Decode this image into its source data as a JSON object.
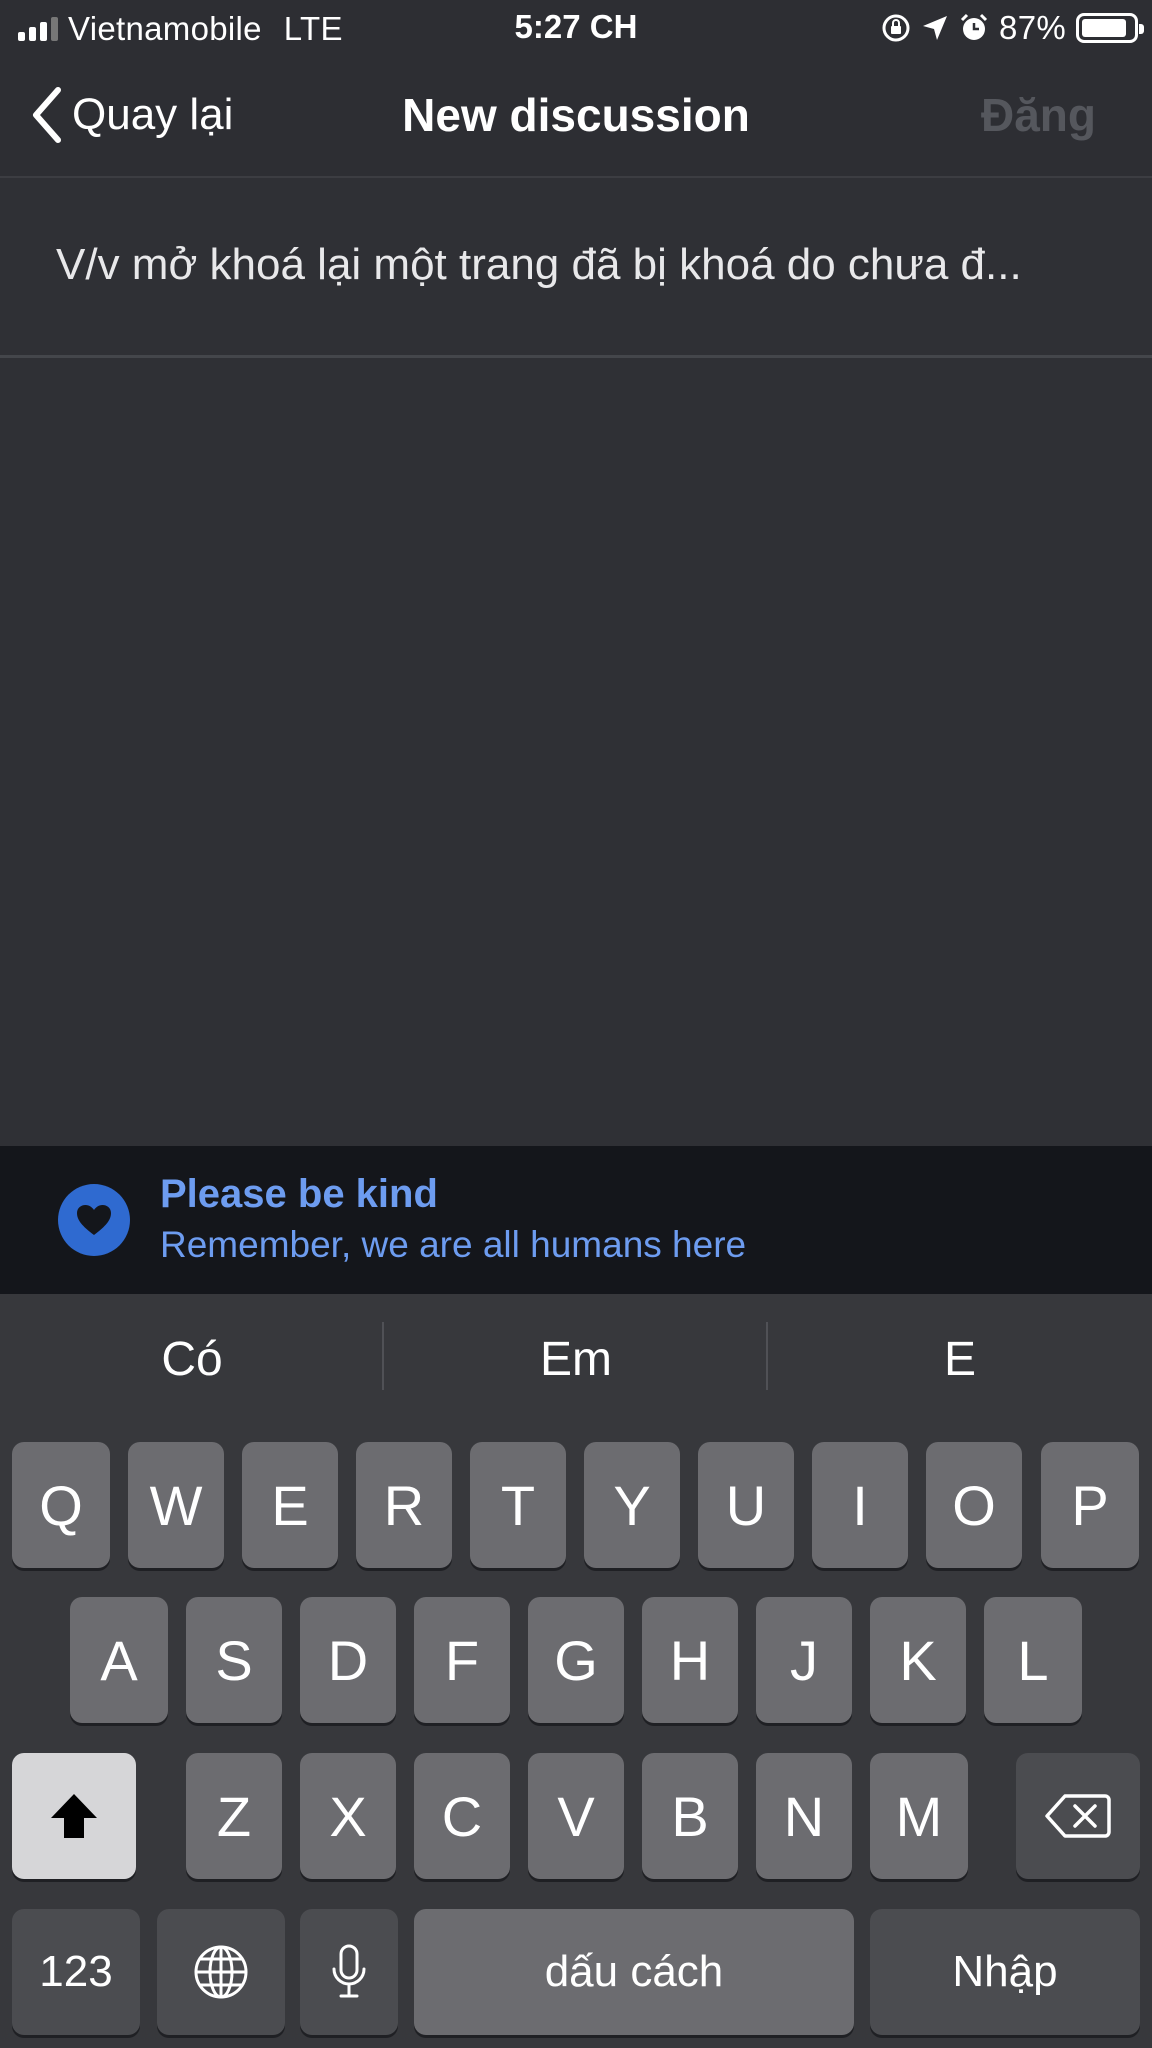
{
  "status_bar": {
    "carrier": "Vietnamobile",
    "network": "LTE",
    "time": "5:27 CH",
    "battery": "87%",
    "battery_level": 0.87,
    "icons": [
      "signal-icon",
      "orientation-lock-icon",
      "location-arrow-icon",
      "alarm-icon",
      "battery-icon"
    ]
  },
  "nav": {
    "back_label": "Quay lại",
    "title": "New discussion",
    "post_label": "Đăng"
  },
  "editor": {
    "title_text": "V/v mở khoá lại một trang đã bị khoá do chưa đ..."
  },
  "banner": {
    "heading": "Please be kind",
    "subtext": "Remember, we are all humans here",
    "icon": "heart-icon",
    "accent": "#6d9cf0"
  },
  "keyboard": {
    "suggestions": [
      "Có",
      "Em",
      "E"
    ],
    "row1": [
      "Q",
      "W",
      "E",
      "R",
      "T",
      "Y",
      "U",
      "I",
      "O",
      "P"
    ],
    "row2": [
      "A",
      "S",
      "D",
      "F",
      "G",
      "H",
      "J",
      "K",
      "L"
    ],
    "row3": [
      "Z",
      "X",
      "C",
      "V",
      "B",
      "N",
      "M"
    ],
    "numbers_label": "123",
    "space_label": "dấu cách",
    "return_label": "Nhập",
    "icons": [
      "shift-icon",
      "backspace-icon",
      "globe-icon",
      "microphone-icon"
    ]
  }
}
